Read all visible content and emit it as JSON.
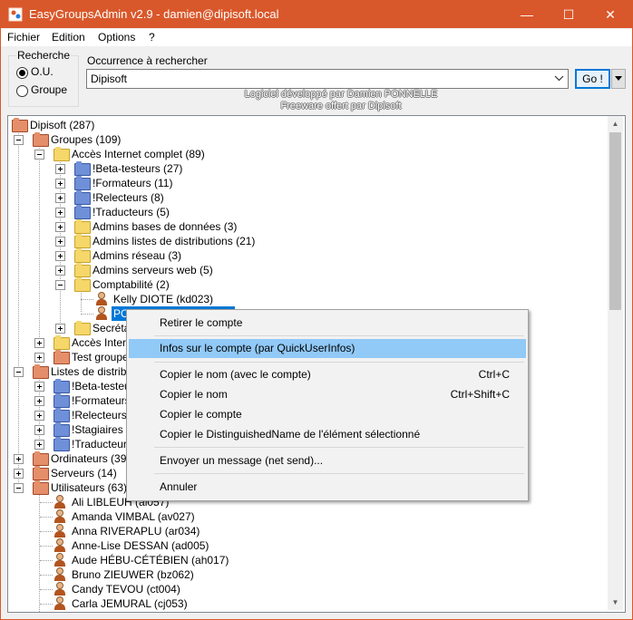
{
  "window": {
    "title": "EasyGroupsAdmin v2.9 - damien@dipisoft.local",
    "minimize_glyph": "—",
    "maximize_glyph": "☐",
    "close_glyph": "✕"
  },
  "menu": [
    "Fichier",
    "Edition",
    "Options",
    "?"
  ],
  "search": {
    "group_label": "Recherche",
    "options": [
      "O.U.",
      "Groupe"
    ],
    "selected": "O.U.",
    "occurrence_label": "Occurrence à rechercher",
    "value": "Dipisoft",
    "go_label": "Go !"
  },
  "credits": [
    "Logiciel développé par Damien PONNELLE",
    "Freeware offert par Dipisoft"
  ],
  "tree": {
    "root": "Dipisoft (287)",
    "groupes": "Groupes (109)",
    "acces_complet": "Accès Internet complet (89)",
    "acces_children": [
      "!Beta-testeurs (27)",
      "!Formateurs (11)",
      "!Relecteurs (8)",
      "!Traducteurs (5)",
      "Admins bases de données (3)",
      "Admins listes de distributions (21)",
      "Admins réseau (3)",
      "Admins serveurs web (5)",
      "Comptabilité (2)"
    ],
    "compta_users": [
      "Kelly DIOTE (kd023)",
      "PO"
    ],
    "secretariat": "Secrétar",
    "acces_partial": "Accès Intern",
    "test_groupes": "Test groupes",
    "listes": "Listes de distributi",
    "listes_children": [
      "!Beta-testeu",
      "!Formateurs",
      "!Relecteurs (",
      "!Stagiaires (",
      "!Traducteurs"
    ],
    "ordinateurs": "Ordinateurs (39)",
    "serveurs": "Serveurs (14)",
    "utilisateurs": "Utilisateurs (63)",
    "users": [
      "Ali LIBLEUH (al057)",
      "Amanda VIMBAL (av027)",
      "Anna RIVERAPLU (ar034)",
      "Anne-Lise DESSAN (ad005)",
      "Aude HÉBU-CÉTÉBIEN (ah017)",
      "Bruno ZIEUWER (bz062)",
      "Candy TEVOU (ct004)",
      "Carla JEMURAL (cj053)"
    ]
  },
  "context_menu": {
    "items": [
      {
        "label": "Retirer le compte",
        "shortcut": ""
      },
      {
        "label": "Infos sur le compte (par QuickUserInfos)",
        "shortcut": ""
      },
      {
        "label": "Copier le nom (avec le compte)",
        "shortcut": "Ctrl+C"
      },
      {
        "label": "Copier le nom",
        "shortcut": "Ctrl+Shift+C"
      },
      {
        "label": "Copier le compte",
        "shortcut": ""
      },
      {
        "label": "Copier le DistinguishedName de l'élément sélectionné",
        "shortcut": ""
      },
      {
        "label": "Envoyer un message (net send)...",
        "shortcut": ""
      },
      {
        "label": "Annuler",
        "shortcut": ""
      }
    ],
    "highlighted": "Infos sur le compte (par QuickUserInfos)"
  },
  "colors": {
    "titlebar": "#d9582b",
    "selection": "#0078d7",
    "menu_highlight": "#91c9f7"
  }
}
